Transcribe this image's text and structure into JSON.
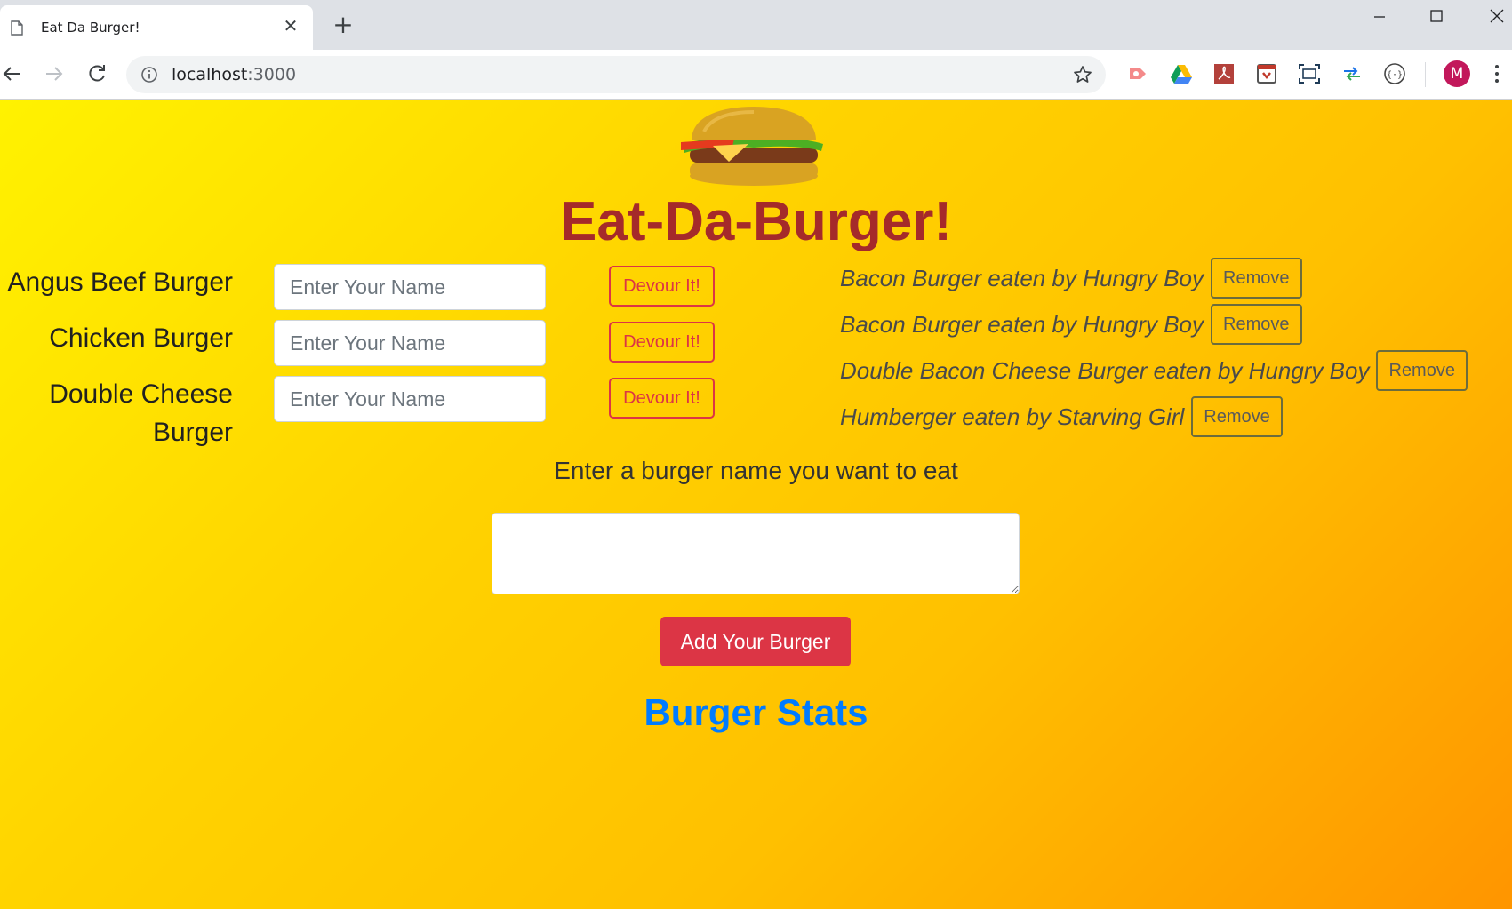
{
  "browser": {
    "tab_title": "Eat Da Burger!",
    "url_host": "localhost",
    "url_port": ":3000",
    "profile_initial": "M",
    "extensions": [
      "cast-icon",
      "google-drive-icon",
      "pdf-icon",
      "shield-extension-icon",
      "screenshot-icon",
      "sync-arrows-icon",
      "code-braces-icon"
    ]
  },
  "page": {
    "title": "Eat-Da-Burger!",
    "burgers": [
      {
        "name_line1": "Angus Beef Burger",
        "name_line2": "",
        "placeholder": "Enter Your Name",
        "devour_label": "Devour It!"
      },
      {
        "name_line1": "Chicken Burger",
        "name_line2": "",
        "placeholder": "Enter Your Name",
        "devour_label": "Devour It!"
      },
      {
        "name_line1": "Double Cheese",
        "name_line2": "Burger",
        "placeholder": "Enter Your Name",
        "devour_label": "Devour It!"
      }
    ],
    "eaten": [
      {
        "text": "Bacon Burger eaten by Hungry Boy",
        "remove_label": "Remove"
      },
      {
        "text": "Bacon Burger eaten by Hungry Boy",
        "remove_label": "Remove"
      },
      {
        "text": "Double Bacon Cheese Burger eaten by Hungry Boy",
        "remove_label": "Remove"
      },
      {
        "text": "Humberger eaten by Starving Girl",
        "remove_label": "Remove"
      }
    ],
    "prompt": "Enter a burger name you want to eat",
    "textarea_value": "",
    "add_button": "Add Your Burger",
    "stats_link": "Burger Stats"
  },
  "colors": {
    "title": "#a52a2a",
    "danger": "#dc3545",
    "link": "#007bff"
  }
}
